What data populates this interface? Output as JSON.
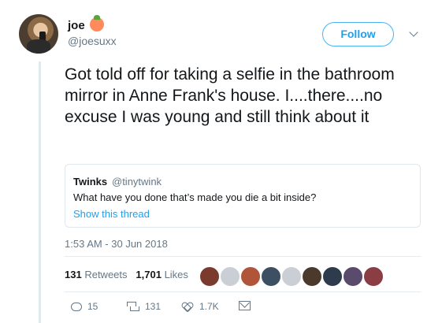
{
  "author": {
    "name": "joe",
    "emoji": "peach",
    "handle": "@joesuxx"
  },
  "follow_label": "Follow",
  "tweet_text": "Got told off for taking a selfie in the bathroom mirror in Anne Frank's house. I....there....no excuse I was young and still think about it",
  "quote": {
    "name": "Twinks",
    "handle": "@tinytwink",
    "text": "What have you done that’s made you die a bit inside?",
    "show_thread": "Show this thread"
  },
  "timestamp": "1:53 AM - 30 Jun 2018",
  "stats": {
    "retweets_count": "131",
    "retweets_label": "Retweets",
    "likes_count": "1,701",
    "likes_label": "Likes"
  },
  "liker_avatars": [
    {
      "color": "#7a3b2e"
    },
    {
      "color": "#c9cfd4"
    },
    {
      "color": "#b0543a"
    },
    {
      "color": "#3d4f63"
    },
    {
      "color": "#c9cfd4"
    },
    {
      "color": "#4b3a2c"
    },
    {
      "color": "#2e3b4c"
    },
    {
      "color": "#5a4a6b"
    },
    {
      "color": "#8a3d43"
    }
  ],
  "actions": {
    "replies": "15",
    "retweets": "131",
    "likes": "1.7K"
  },
  "colors": {
    "accent": "#1da1f2",
    "muted": "#657786",
    "text": "#14171a"
  }
}
